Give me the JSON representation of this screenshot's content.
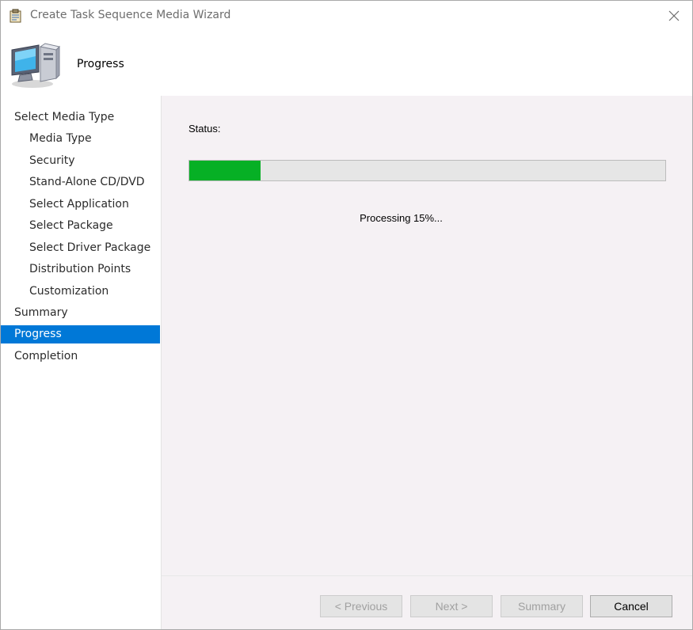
{
  "window": {
    "title": "Create Task Sequence Media Wizard",
    "title_icon": "wizard-clipboard-icon",
    "close_icon": "close-icon"
  },
  "header": {
    "icon": "computer-icon",
    "title": "Progress"
  },
  "nav": {
    "items": [
      {
        "label": "Select Media Type",
        "level": 0,
        "selected": false
      },
      {
        "label": "Media Type",
        "level": 1,
        "selected": false
      },
      {
        "label": "Security",
        "level": 1,
        "selected": false
      },
      {
        "label": "Stand-Alone CD/DVD",
        "level": 1,
        "selected": false
      },
      {
        "label": "Select Application",
        "level": 1,
        "selected": false
      },
      {
        "label": "Select Package",
        "level": 1,
        "selected": false
      },
      {
        "label": "Select Driver Package",
        "level": 1,
        "selected": false
      },
      {
        "label": "Distribution Points",
        "level": 1,
        "selected": false
      },
      {
        "label": "Customization",
        "level": 1,
        "selected": false
      },
      {
        "label": "Summary",
        "level": 0,
        "selected": false
      },
      {
        "label": "Progress",
        "level": 0,
        "selected": true
      },
      {
        "label": "Completion",
        "level": 0,
        "selected": false
      }
    ]
  },
  "main": {
    "status_label": "Status:",
    "progress_fraction": 0.15,
    "progress_text": "Processing 15%..."
  },
  "footer": {
    "previous_label": "< Previous",
    "next_label": "Next >",
    "summary_label": "Summary",
    "cancel_label": "Cancel"
  },
  "colors": {
    "selection": "#0078d7",
    "progress_fill": "#06b025",
    "content_background": "#f5f1f4"
  }
}
